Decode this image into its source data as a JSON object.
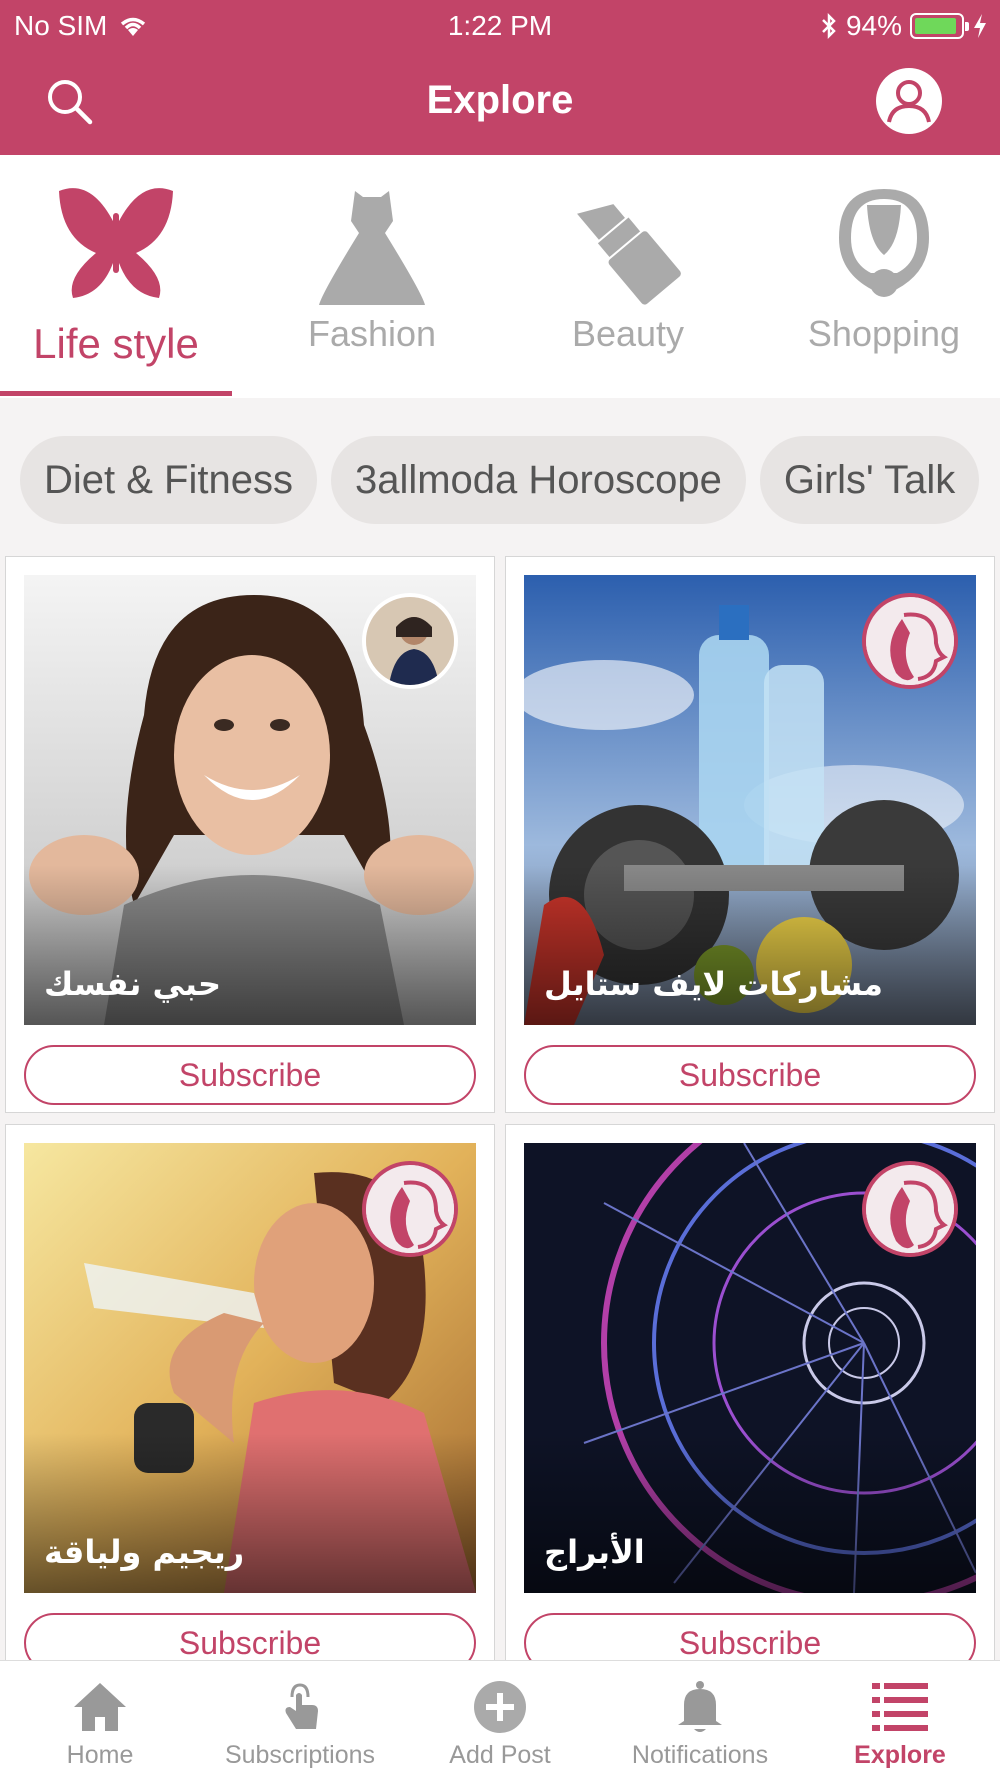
{
  "status": {
    "carrier": "No SIM",
    "time": "1:22 PM",
    "battery": "94%",
    "battery_level": 0.94
  },
  "header": {
    "title": "Explore"
  },
  "categories": [
    {
      "label": "Life style",
      "icon": "butterfly-icon",
      "active": true
    },
    {
      "label": "Fashion",
      "icon": "dress-icon",
      "active": false
    },
    {
      "label": "Beauty",
      "icon": "lipstick-icon",
      "active": false
    },
    {
      "label": "Shopping",
      "icon": "necklace-icon",
      "active": false
    }
  ],
  "chips": [
    "Diet & Fitness",
    "3allmoda Horoscope",
    "Girls' Talk"
  ],
  "cards": [
    {
      "title": "حبي نفسك",
      "button": "Subscribe",
      "image": "smiling-woman-photo",
      "badge": "user-avatar"
    },
    {
      "title": "مشاركات لايف ستايل",
      "button": "Subscribe",
      "image": "water-bottle-dumbbells-photo",
      "badge": "brand-logo"
    },
    {
      "title": "ريجيم ولياقة",
      "button": "Subscribe",
      "image": "woman-drinking-water-photo",
      "badge": "brand-logo"
    },
    {
      "title": "الأبراج",
      "button": "Subscribe",
      "image": "zodiac-wheel-photo",
      "badge": "brand-logo"
    }
  ],
  "tabs": [
    {
      "label": "Home",
      "icon": "home-icon",
      "active": false
    },
    {
      "label": "Subscriptions",
      "icon": "tap-hand-icon",
      "active": false
    },
    {
      "label": "Add Post",
      "icon": "plus-circle-icon",
      "active": false
    },
    {
      "label": "Notifications",
      "icon": "bell-icon",
      "active": false
    },
    {
      "label": "Explore",
      "icon": "list-icon",
      "active": true
    }
  ],
  "colors": {
    "brand": "#c24468",
    "inactive": "#aaaaaa",
    "chip_bg": "#e7e4e3"
  }
}
